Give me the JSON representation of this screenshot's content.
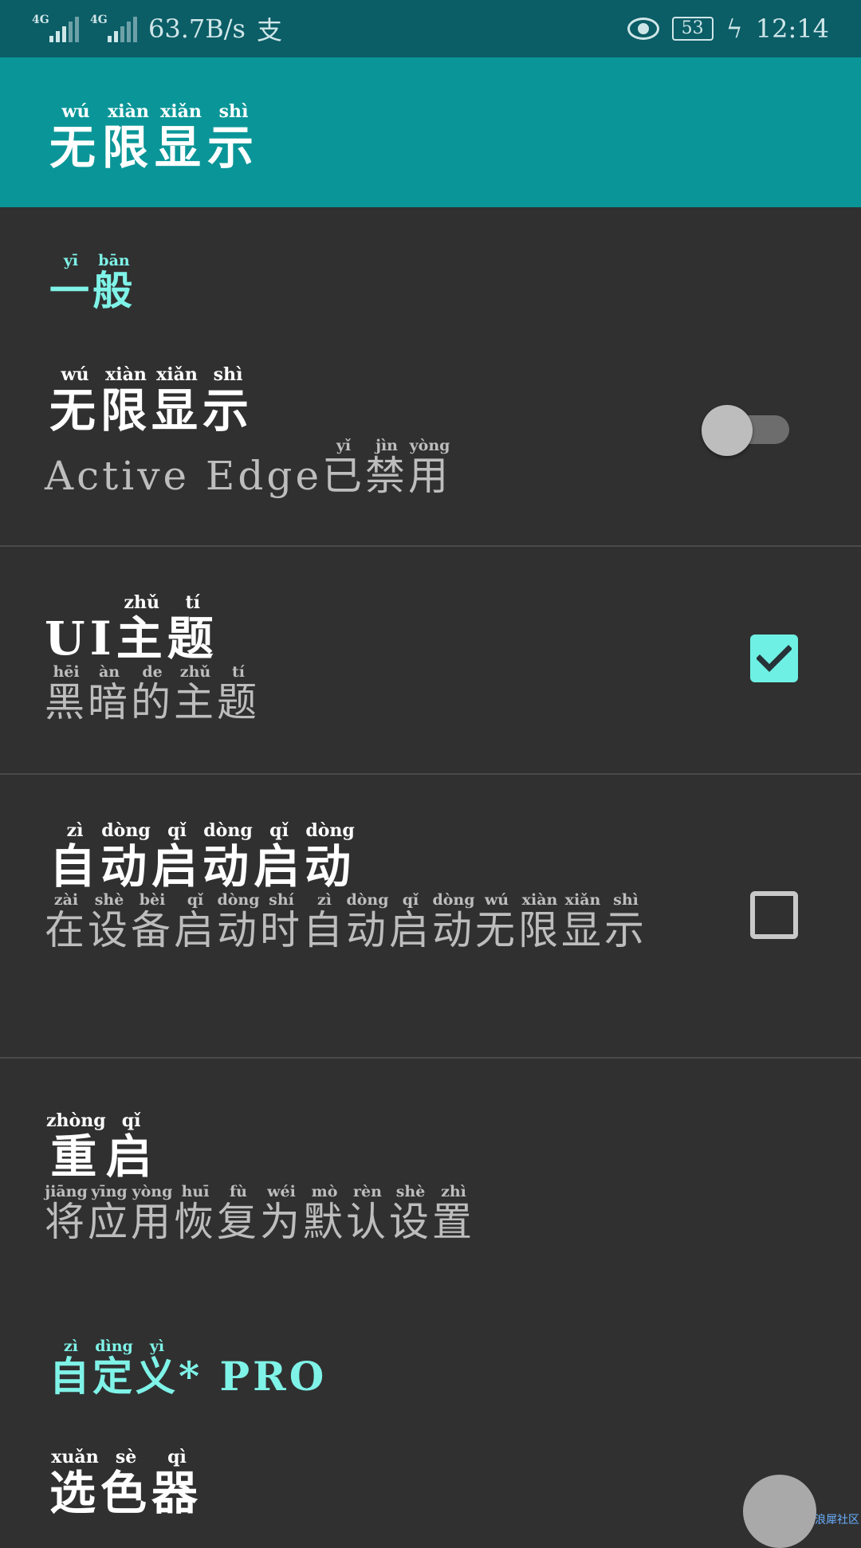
{
  "status_bar": {
    "network1": "4G",
    "network2": "4G",
    "speed": "63.7B/s",
    "pay_icon_text": "支",
    "battery": "53",
    "time": "12:14"
  },
  "app_bar": {
    "title": [
      {
        "c": "无",
        "p": "wú"
      },
      {
        "c": "限",
        "p": "xiàn"
      },
      {
        "c": "显",
        "p": "xiǎn"
      },
      {
        "c": "示",
        "p": "shì"
      }
    ]
  },
  "sections": {
    "general": [
      {
        "c": "一",
        "p": "yī"
      },
      {
        "c": "般",
        "p": "bān"
      }
    ],
    "custom": [
      {
        "c": "自",
        "p": "zì"
      },
      {
        "c": "定",
        "p": "dìng"
      },
      {
        "c": "义",
        "p": "yì"
      },
      {
        "c": "* PRO",
        "p": ""
      }
    ]
  },
  "settings": {
    "infinite_display": {
      "title": [
        {
          "c": "无",
          "p": "wú"
        },
        {
          "c": "限",
          "p": "xiàn"
        },
        {
          "c": "显",
          "p": "xiǎn"
        },
        {
          "c": "示",
          "p": "shì"
        }
      ],
      "summary": [
        {
          "c": "Active Edge",
          "p": ""
        },
        {
          "c": "已",
          "p": "yǐ"
        },
        {
          "c": "禁",
          "p": "jìn"
        },
        {
          "c": "用",
          "p": "yòng"
        }
      ],
      "enabled": false
    },
    "ui_theme": {
      "title": [
        {
          "c": "UI",
          "p": ""
        },
        {
          "c": "主",
          "p": "zhǔ"
        },
        {
          "c": "题",
          "p": "tí"
        }
      ],
      "summary": [
        {
          "c": "黑",
          "p": "hēi"
        },
        {
          "c": "暗",
          "p": "àn"
        },
        {
          "c": "的",
          "p": "de"
        },
        {
          "c": "主",
          "p": "zhǔ"
        },
        {
          "c": "题",
          "p": "tí"
        }
      ],
      "checked": true
    },
    "autostart": {
      "title": [
        {
          "c": "自",
          "p": "zì"
        },
        {
          "c": "动",
          "p": "dòng"
        },
        {
          "c": "启",
          "p": "qǐ"
        },
        {
          "c": "动",
          "p": "dòng"
        },
        {
          "c": "启",
          "p": "qǐ"
        },
        {
          "c": "动",
          "p": "dòng"
        }
      ],
      "summary": [
        {
          "c": "在",
          "p": "zài"
        },
        {
          "c": "设",
          "p": "shè"
        },
        {
          "c": "备",
          "p": "bèi"
        },
        {
          "c": "启",
          "p": "qǐ"
        },
        {
          "c": "动",
          "p": "dòng"
        },
        {
          "c": "时",
          "p": "shí"
        },
        {
          "c": "自",
          "p": "zì"
        },
        {
          "c": "动",
          "p": "dòng"
        },
        {
          "c": "启",
          "p": "qǐ"
        },
        {
          "c": "动",
          "p": "dòng"
        },
        {
          "c": "无",
          "p": "wú"
        },
        {
          "c": "限",
          "p": "xiàn"
        },
        {
          "c": "显",
          "p": "xiǎn"
        },
        {
          "c": "示",
          "p": "shì"
        }
      ],
      "checked": false
    },
    "restart": {
      "title": [
        {
          "c": "重",
          "p": "zhòng"
        },
        {
          "c": "启",
          "p": "qǐ"
        }
      ],
      "summary": [
        {
          "c": "将",
          "p": "jiāng"
        },
        {
          "c": "应",
          "p": "yīng"
        },
        {
          "c": "用",
          "p": "yòng"
        },
        {
          "c": "恢",
          "p": "huī"
        },
        {
          "c": "复",
          "p": "fù"
        },
        {
          "c": "为",
          "p": "wéi"
        },
        {
          "c": "默",
          "p": "mò"
        },
        {
          "c": "认",
          "p": "rèn"
        },
        {
          "c": "设",
          "p": "shè"
        },
        {
          "c": "置",
          "p": "zhì"
        }
      ]
    },
    "color_picker": {
      "title": [
        {
          "c": "选",
          "p": "xuǎn"
        },
        {
          "c": "色",
          "p": "sè"
        },
        {
          "c": "器",
          "p": "qì"
        }
      ],
      "color": "#a9a9a9"
    }
  },
  "watermark": "浪犀社区",
  "colors": {
    "status_bar": "#0b5d66",
    "app_bar": "#0a9698",
    "background": "#303030",
    "accent": "#7ff3e8"
  }
}
